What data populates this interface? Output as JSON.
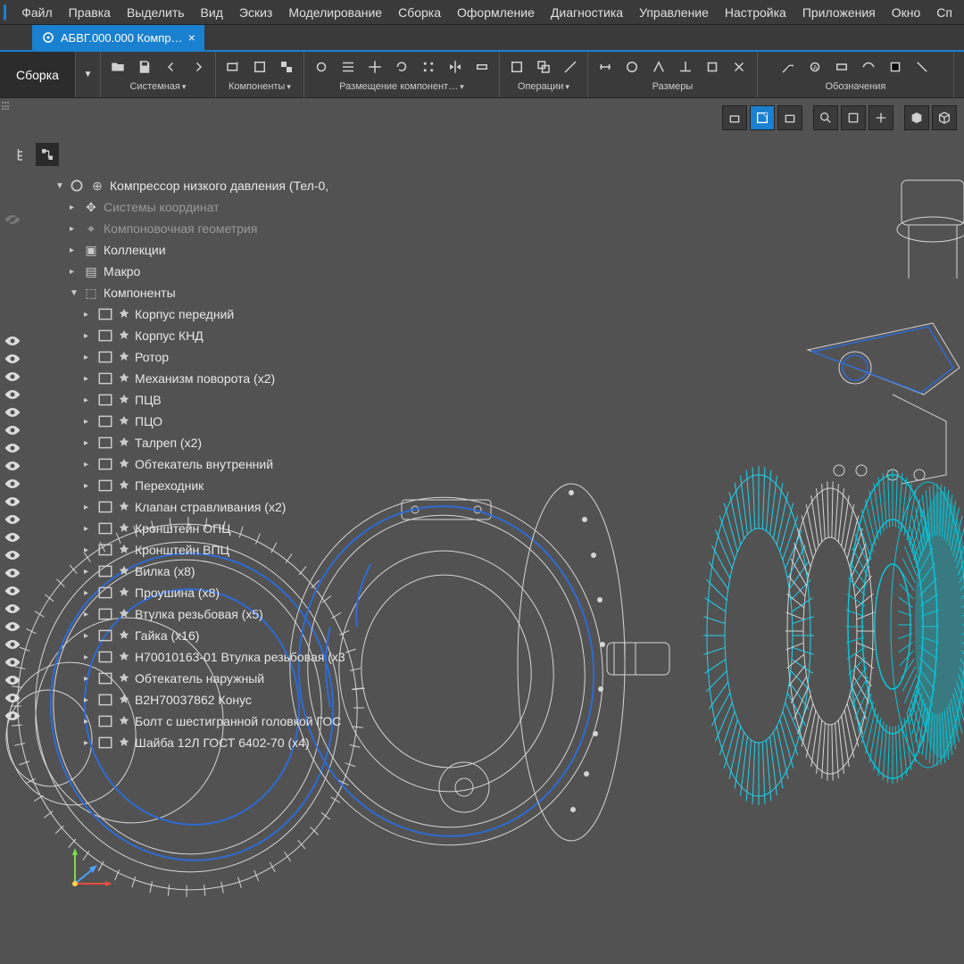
{
  "menu": {
    "items": [
      "Файл",
      "Правка",
      "Выделить",
      "Вид",
      "Эскиз",
      "Моделирование",
      "Сборка",
      "Оформление",
      "Диагностика",
      "Управление",
      "Настройка",
      "Приложения",
      "Окно",
      "Сп"
    ]
  },
  "tab": {
    "title": "АБВГ.000.000 Компр…",
    "close": "×"
  },
  "mode": {
    "label": "Сборка"
  },
  "toolgroups": {
    "g0": "Системная",
    "g1": "Компоненты",
    "g2": "Размещение компонент…",
    "g3": "Операции",
    "g4": "Размеры",
    "g5": "Обозначения"
  },
  "tree": {
    "root": "Компрессор низкого давления (Тел-0,",
    "n_coord": "Системы координат",
    "n_layout": "Компоновочная геометрия",
    "n_coll": "Коллекции",
    "n_macro": "Макро",
    "n_comp": "Компоненты",
    "c0": "Корпус передний",
    "c1": "Корпус КНД",
    "c2": "Ротор",
    "c3": "Механизм поворота (x2)",
    "c4": "ПЦВ",
    "c5": "ПЦО",
    "c6": "Талреп (x2)",
    "c7": "Обтекатель внутренний",
    "c8": "Переходник",
    "c9": "Клапан стравливания (x2)",
    "c10": "Кронштейн ОПЦ",
    "c11": "Кронштейн ВПЦ",
    "c12": "Вилка (x8)",
    "c13": "Проушина (x8)",
    "c14": "Втулка резьбовая (x5)",
    "c15": "Гайка (x16)",
    "c16": "Н70010163-01 Втулка резьбовая (x3",
    "c17": "Обтекатель наружный",
    "c18": "В2Н70037862 Конус",
    "c19": "Болт с шестигранной головкой ГОС",
    "c20": "Шайба 12Л ГОСТ 6402-70 (x4)"
  }
}
